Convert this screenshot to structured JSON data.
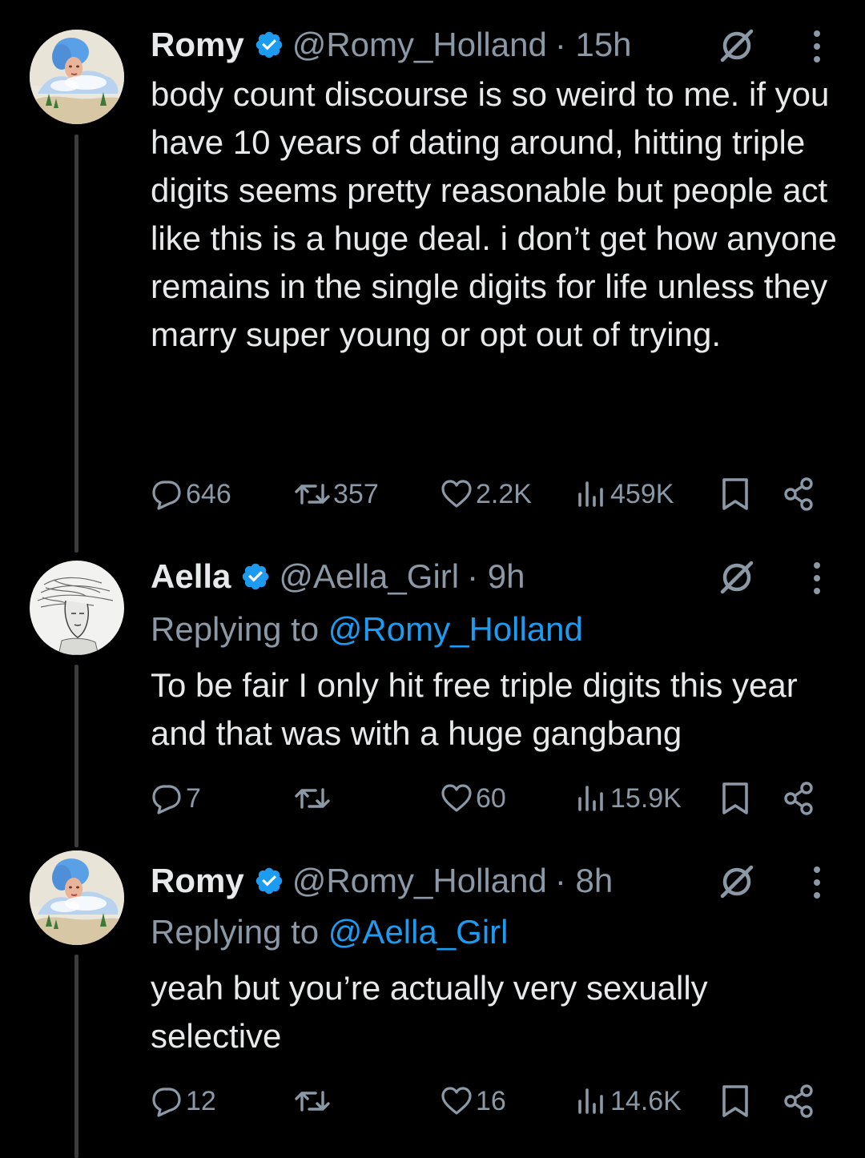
{
  "colors": {
    "background": "#000000",
    "text": "#e7e9ea",
    "muted": "#8b98a5",
    "link": "#1d9bf0",
    "verified": "#1d9bf0",
    "thread_line": "#3a3d40"
  },
  "tweets": [
    {
      "name": "Romy",
      "handle": "@Romy_Holland",
      "time": "· 15h",
      "avatar_icon": "avatar-romy",
      "replying_label": "",
      "replying_to": "",
      "body": "body count discourse is so weird to me. if you have 10 years of dating around, hitting triple digits seems pretty reasonable but people act like this is a huge deal. i don’t get how anyone remains in the single digits for life unless they marry super young or opt out of trying.",
      "stats": {
        "replies": "646",
        "retweets": "357",
        "likes": "2.2K",
        "views": "459K"
      }
    },
    {
      "name": "Aella",
      "handle": "@Aella_Girl",
      "time": "· 9h",
      "avatar_icon": "avatar-aella",
      "replying_label": "Replying to",
      "replying_to": "@Romy_Holland",
      "body": "To be fair I only hit free triple digits this year and that was with a huge gangbang",
      "stats": {
        "replies": "7",
        "retweets": "",
        "likes": "60",
        "views": "15.9K"
      }
    },
    {
      "name": "Romy",
      "handle": "@Romy_Holland",
      "time": "· 8h",
      "avatar_icon": "avatar-romy",
      "replying_label": "Replying to",
      "replying_to": "@Aella_Girl",
      "body": "yeah but you’re actually very sexually selective",
      "stats": {
        "replies": "12",
        "retweets": "",
        "likes": "16",
        "views": "14.6K"
      }
    }
  ]
}
